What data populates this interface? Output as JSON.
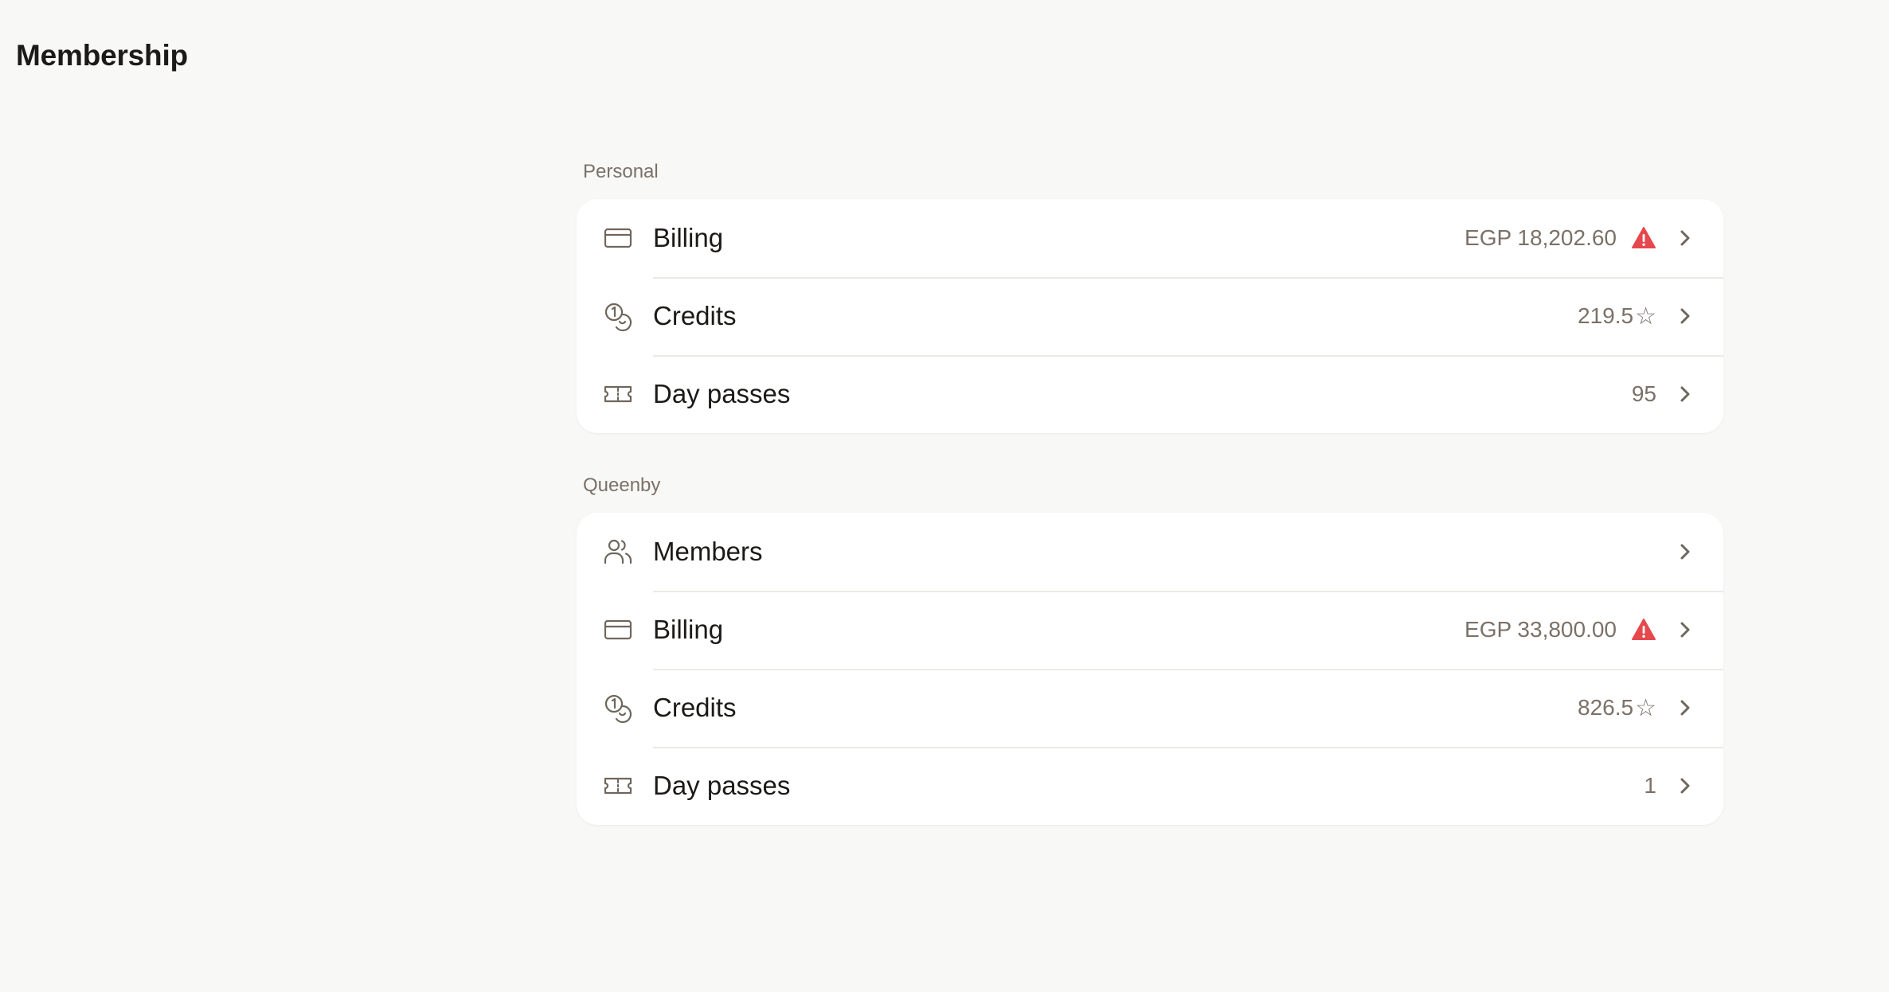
{
  "page": {
    "title": "Membership"
  },
  "sections": {
    "personal": {
      "label": "Personal",
      "billing": {
        "label": "Billing",
        "value": "EGP 18,202.60",
        "warning": true
      },
      "credits": {
        "label": "Credits",
        "value": "219.5",
        "value_suffix": "☆"
      },
      "day_passes": {
        "label": "Day passes",
        "value": "95"
      }
    },
    "queenby": {
      "label": "Queenby",
      "members": {
        "label": "Members"
      },
      "billing": {
        "label": "Billing",
        "value": "EGP 33,800.00",
        "warning": true
      },
      "credits": {
        "label": "Credits",
        "value": "826.5",
        "value_suffix": "☆"
      },
      "day_passes": {
        "label": "Day passes",
        "value": "1"
      }
    }
  },
  "icons": {
    "billing": "credit-card-icon",
    "credits": "coins-icon",
    "day_passes": "ticket-icon",
    "members": "users-icon",
    "warning": "warning-triangle-icon",
    "chevron": "chevron-right-icon"
  },
  "colors": {
    "background": "#f8f8f6",
    "card": "#ffffff",
    "text_primary": "#1c1a17",
    "text_secondary": "#7b7168",
    "icon": "#6f665c",
    "warning": "#e5484d",
    "divider": "#ebe9e6"
  }
}
